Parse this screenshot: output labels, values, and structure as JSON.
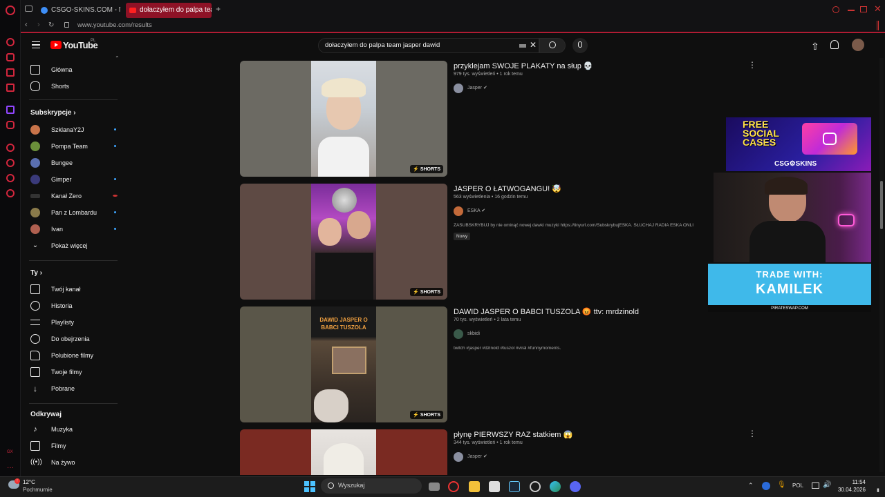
{
  "browser": {
    "tabs": [
      {
        "label": "CSGO-SKINS.COM - Najs",
        "active": false
      },
      {
        "label": "dołaczyłem do palpa team",
        "active": true
      }
    ],
    "url": "www.youtube.com/results"
  },
  "youtube": {
    "logo": "YouTube",
    "logo_region": "PL",
    "search_query": "dołaczyłem do palpa team jasper dawid"
  },
  "sidebar": {
    "main": [
      {
        "label": "Główna",
        "icon": "home-icon"
      },
      {
        "label": "Shorts",
        "icon": "shorts-icon"
      }
    ],
    "subscriptions_title": "Subskrypcje",
    "subscriptions": [
      {
        "label": "SzklanaY2J",
        "color": "#c9744a",
        "dot": "blue"
      },
      {
        "label": "Pompa Team",
        "color": "#6b8f3a",
        "dot": "blue"
      },
      {
        "label": "Bungee",
        "color": "#5a6fb0",
        "dot": "none"
      },
      {
        "label": "Gimper",
        "color": "#3a3a7a",
        "dot": "blue"
      },
      {
        "label": "Kanał Zero",
        "color": "#2a2a2a",
        "dot": "live"
      },
      {
        "label": "Pan z Lombardu",
        "color": "#8a7a4a",
        "dot": "blue"
      },
      {
        "label": "Ivan",
        "color": "#b06050",
        "dot": "blue"
      }
    ],
    "show_more": "Pokaż więcej",
    "you_title": "Ty",
    "you": [
      {
        "label": "Twój kanał",
        "icon": "channel-icon"
      },
      {
        "label": "Historia",
        "icon": "history-icon"
      },
      {
        "label": "Playlisty",
        "icon": "playlist-icon"
      },
      {
        "label": "Do obejrzenia",
        "icon": "clock-icon"
      },
      {
        "label": "Polubione filmy",
        "icon": "like-icon"
      },
      {
        "label": "Twoje filmy",
        "icon": "video-icon"
      },
      {
        "label": "Pobrane",
        "icon": "download-icon"
      }
    ],
    "explore_title": "Odkrywaj",
    "explore": [
      {
        "label": "Muzyka",
        "icon": "music-icon"
      },
      {
        "label": "Filmy",
        "icon": "film-icon"
      },
      {
        "label": "Na żywo",
        "icon": "live-icon"
      }
    ]
  },
  "results": [
    {
      "title": "przyklejam SWOJE PLAKATY na słup 💀",
      "meta": "979 tys. wyświetleń • 1 rok temu",
      "channel": "Jasper",
      "description": "",
      "badge": "",
      "shorts_label": "SHORTS",
      "overlay_text": "",
      "bg_color": "#6c6a63",
      "center_color": "#c8cfd6"
    },
    {
      "title": "JASPER O ŁATWOGANGU! 🤯",
      "meta": "563 wyświetlenia • 16 godzin temu",
      "channel": "ESKA",
      "description": "ZASUBSKRYBUJ by nie ominąć nowej dawki muzyki https://tinyurl.com/SubskrybujESKA. SŁUCHAJ RADIA ESKA ONLI",
      "badge": "Nowy",
      "shorts_label": "SHORTS",
      "overlay_text": "",
      "bg_color": "#5e4a44",
      "center_color": "#a23ab0"
    },
    {
      "title": "DAWID JASPER O BABCI TUSZOLA 😡 ttv: mrdzinold",
      "meta": "70 tys. wyświetleń • 2 lata temu",
      "channel": "skbidi",
      "description": "twitch #jasper #dzinold #tuszol #viral #funnymoments.",
      "badge": "",
      "shorts_label": "SHORTS",
      "overlay_text": "DAWID JASPER O BABCI TUSZOLA",
      "bg_color": "#5a5649",
      "center_color": "#5a4a3a"
    },
    {
      "title": "płynę PIERWSZY RAZ statkiem 😱",
      "meta": "344 tys. wyświetleń • 1 rok temu",
      "channel": "Jasper",
      "description": "",
      "badge": "",
      "shorts_label": "",
      "overlay_text": "",
      "bg_color": "#7a2a22",
      "center_color": "#d8d4d0"
    }
  ],
  "overlays": {
    "free_cases_line1": "FREE",
    "free_cases_line2": "SOCIAL",
    "free_cases_line3": "CASES",
    "csgo_skins": "CSG⚙SKINS",
    "trade_line1": "TRADE WITH:",
    "trade_line2": "KAMILEK",
    "trade_site": "PIRATESWAP.COM"
  },
  "taskbar": {
    "temperature": "12°C",
    "weather": "Pochmurnie",
    "search_placeholder": "Wyszukaj",
    "language": "POL",
    "time": "11:54",
    "date": "30.04.2026"
  }
}
